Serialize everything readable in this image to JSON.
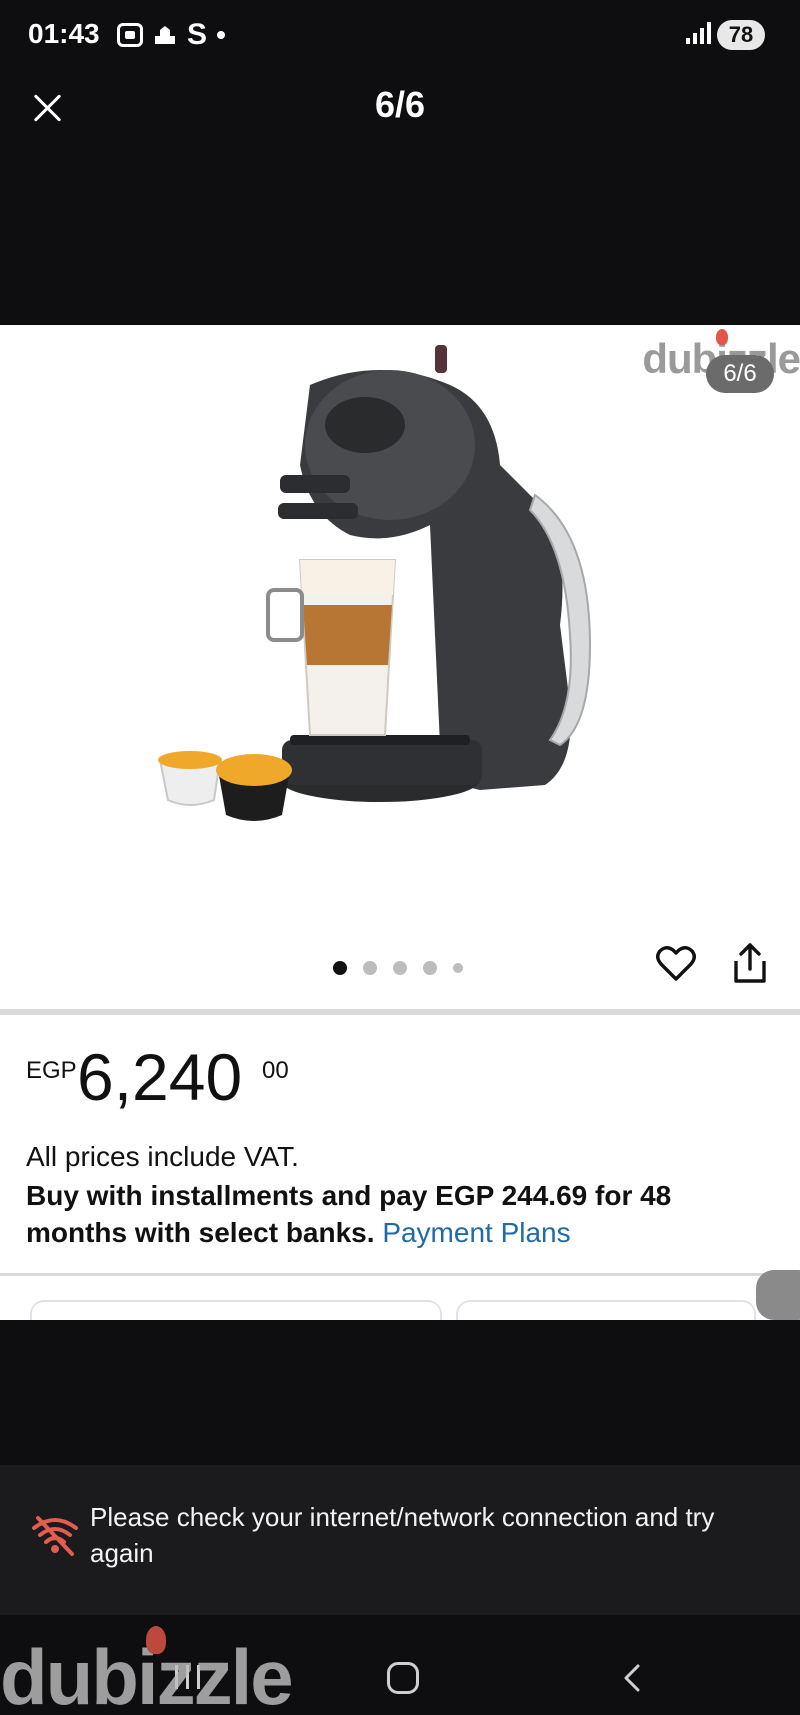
{
  "status_bar": {
    "time": "01:43",
    "carrier_letter": "S",
    "battery": "78"
  },
  "header": {
    "title": "6/6"
  },
  "gallery": {
    "watermark": "dubizzle",
    "image_badge": "6/6",
    "dots_total": 5,
    "dots_active_index": 0
  },
  "price": {
    "currency": "EGP",
    "amount": "6,240",
    "cents": "00",
    "vat_note": "All prices include VAT.",
    "installment_text": "Buy with installments and pay EGP 244.69 for 48 months with select banks.",
    "installment_link": "Payment Plans"
  },
  "toast": {
    "message": "Please check your internet/network connection and try again"
  },
  "footer_watermark": "dubizzle",
  "colors": {
    "accent_link": "#1f6aa8",
    "brand_flame": "#e3574a",
    "toast_bg": "#1b1b1e"
  }
}
